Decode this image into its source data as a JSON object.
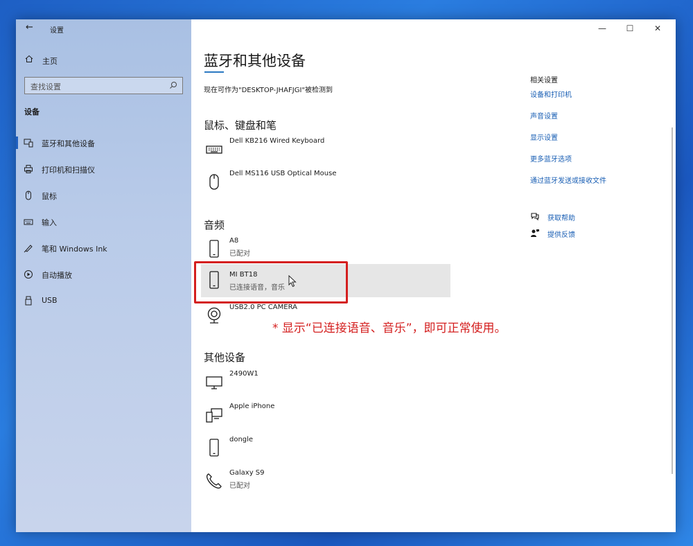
{
  "window": {
    "title": "设置"
  },
  "sidebar": {
    "home_label": "主页",
    "search_placeholder": "查找设置",
    "section_label": "设备",
    "items": [
      {
        "label": "蓝牙和其他设备",
        "icon": "bluetooth-devices-icon",
        "active": true
      },
      {
        "label": "打印机和扫描仪",
        "icon": "printer-icon"
      },
      {
        "label": "鼠标",
        "icon": "mouse-icon"
      },
      {
        "label": "输入",
        "icon": "keyboard-icon"
      },
      {
        "label": "笔和 Windows Ink",
        "icon": "pen-icon"
      },
      {
        "label": "自动播放",
        "icon": "autoplay-icon"
      },
      {
        "label": "USB",
        "icon": "usb-icon"
      }
    ]
  },
  "main": {
    "page_title": "蓝牙和其他设备",
    "discover_text": "现在可作为\"DESKTOP-JHAFJGI\"被检测到",
    "groups": {
      "input": {
        "title": "鼠标、键盘和笔",
        "devices": [
          {
            "name": "Dell KB216 Wired Keyboard",
            "icon": "keyboard-icon"
          },
          {
            "name": "Dell MS116 USB Optical Mouse",
            "icon": "mouse-icon"
          }
        ]
      },
      "audio": {
        "title": "音频",
        "devices": [
          {
            "name": "A8",
            "status": "已配对",
            "icon": "phone-icon"
          },
          {
            "name": "MI BT18",
            "status": "已连接语音，音乐",
            "icon": "phone-icon"
          },
          {
            "name": "USB2.0 PC CAMERA",
            "icon": "webcam-icon"
          }
        ]
      },
      "other": {
        "title": "其他设备",
        "devices": [
          {
            "name": "2490W1",
            "icon": "monitor-icon"
          },
          {
            "name": "Apple iPhone",
            "icon": "devices-icon"
          },
          {
            "name": "dongle",
            "icon": "phone-icon"
          },
          {
            "name": "Galaxy S9",
            "status": "已配对",
            "icon": "handset-icon"
          }
        ]
      }
    }
  },
  "related": {
    "title": "相关设置",
    "links": [
      "设备和打印机",
      "声音设置",
      "显示设置",
      "更多蓝牙选项",
      "通过蓝牙发送或接收文件"
    ],
    "help": [
      {
        "label": "获取帮助",
        "icon": "help-icon"
      },
      {
        "label": "提供反馈",
        "icon": "feedback-icon"
      }
    ]
  },
  "annotation": {
    "text": "* 显示“已连接语音、音乐”，即可正常使用。"
  },
  "colors": {
    "accent": "#2b79c2",
    "link": "#1a5fb4",
    "annotation": "#d41f1f"
  }
}
